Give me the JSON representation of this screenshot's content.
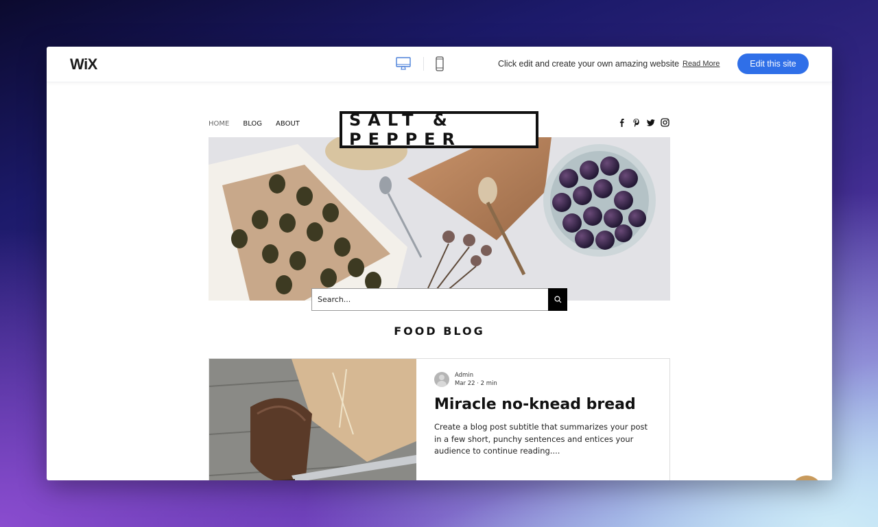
{
  "topbar": {
    "logo": "WiX",
    "devices": [
      {
        "name": "desktop",
        "icon": "desktop-icon",
        "active": true
      },
      {
        "name": "mobile",
        "icon": "mobile-icon",
        "active": false
      }
    ],
    "promo_text": "Click edit and create your own amazing website",
    "read_more": "Read More",
    "edit_button": "Edit this site",
    "accent_color": "#2f6fe8"
  },
  "site": {
    "nav": [
      {
        "label": "HOME",
        "active": true
      },
      {
        "label": "BLOG",
        "active": false
      },
      {
        "label": "ABOUT",
        "active": false
      }
    ],
    "brand": "SALT & PEPPER",
    "social": [
      "facebook-icon",
      "pinterest-icon",
      "twitter-icon",
      "instagram-icon"
    ],
    "search": {
      "placeholder": "Search..."
    },
    "section_title": "FOOD BLOG",
    "post": {
      "author": "Admin",
      "date": "Mar 22",
      "read_time": "2 min",
      "title": "Miracle no-knead bread",
      "excerpt": "Create a blog post subtitle that summarizes your post in a few short, punchy sentences and entices your audience to continue reading...."
    }
  },
  "chat": {
    "icon": "chat-icon",
    "color": "#c89a5c"
  }
}
